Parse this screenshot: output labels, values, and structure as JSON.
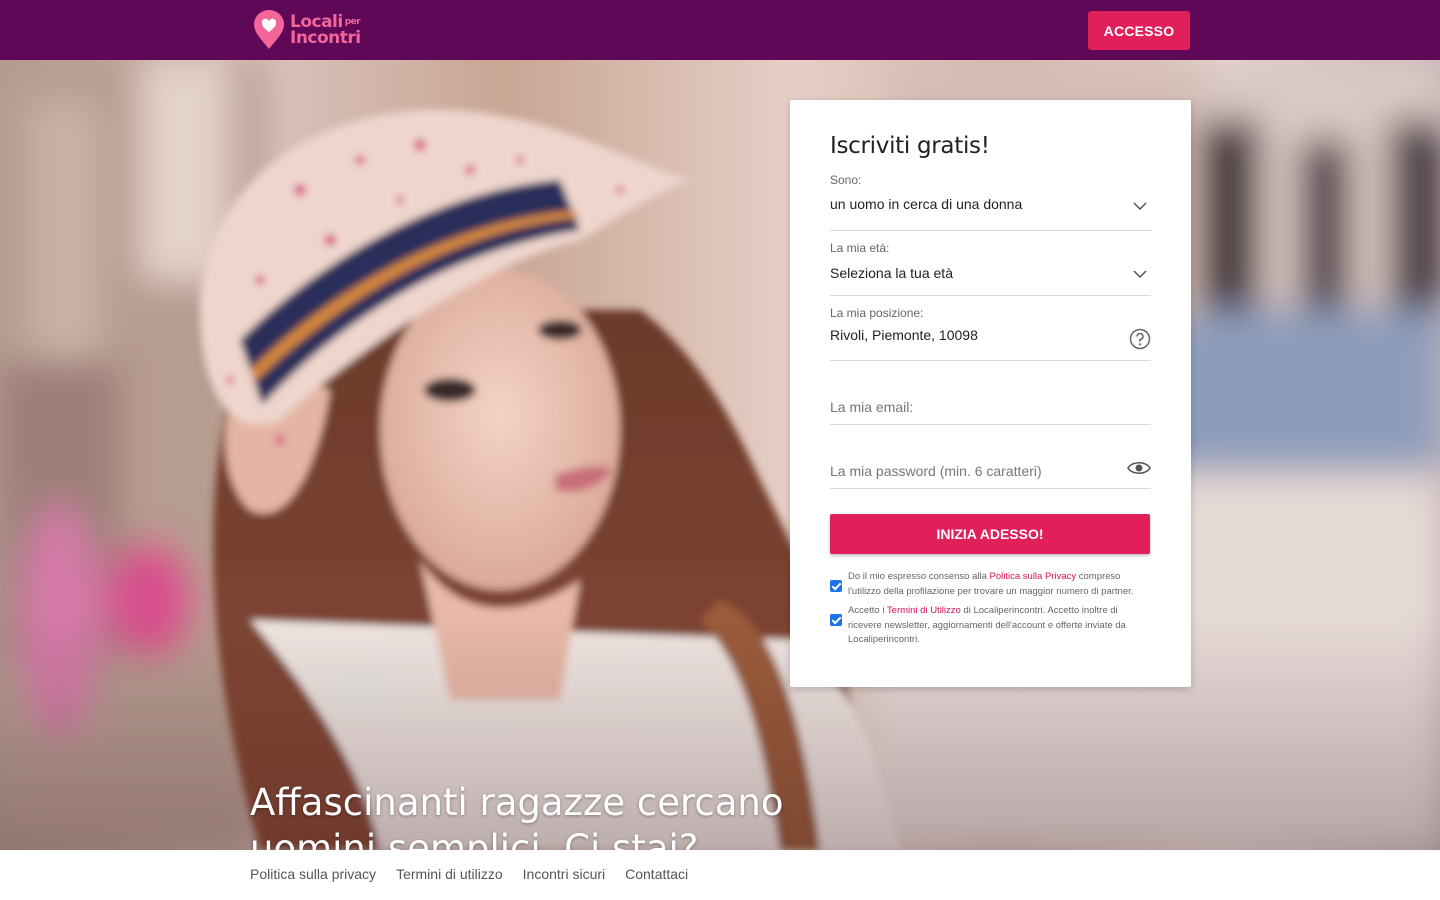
{
  "header": {
    "logo_line1": "Locali",
    "logo_per": "per",
    "logo_line2": "Incontri",
    "login_label": "ACCESSO",
    "brand_color": "#5f0857"
  },
  "hero": {
    "headline": "Affascinanti ragazze cercano uomini semplici. Ci stai?"
  },
  "signup": {
    "title": "Iscriviti gratis!",
    "gender": {
      "label": "Sono:",
      "value": "un uomo in cerca di una donna",
      "icon": "chevron-down-icon"
    },
    "age": {
      "label": "La mia età:",
      "value": "Seleziona la tua età",
      "icon": "chevron-down-icon"
    },
    "location": {
      "label": "La mia posizione:",
      "value": "Rivoli, Piemonte, 10098",
      "icon": "help-icon"
    },
    "email": {
      "placeholder": "La mia email:"
    },
    "password": {
      "placeholder": "La mia password (min. 6 caratteri)",
      "icon": "eye-icon"
    },
    "submit_label": "INIZIA ADESSO!",
    "accent_color": "#e01f5b",
    "consent_privacy": {
      "before": "Do il mio espresso consenso alla ",
      "link": "Politica sulla Privacy",
      "after": " compreso l'utilizzo della profilazione per trovare un maggior numero di partner.",
      "checked": true
    },
    "consent_terms": {
      "before": "Accetto i ",
      "link": "Termini di Utilizzo",
      "after": " di Localiperincontri. Accetto inoltre di ricevere newsletter, aggiornamenti dell'account e offerte inviate da Localiperincontri.",
      "checked": true
    }
  },
  "footer": {
    "links": [
      "Politica sulla privacy",
      "Termini di utilizzo",
      "Incontri sicuri",
      "Contattaci"
    ]
  }
}
